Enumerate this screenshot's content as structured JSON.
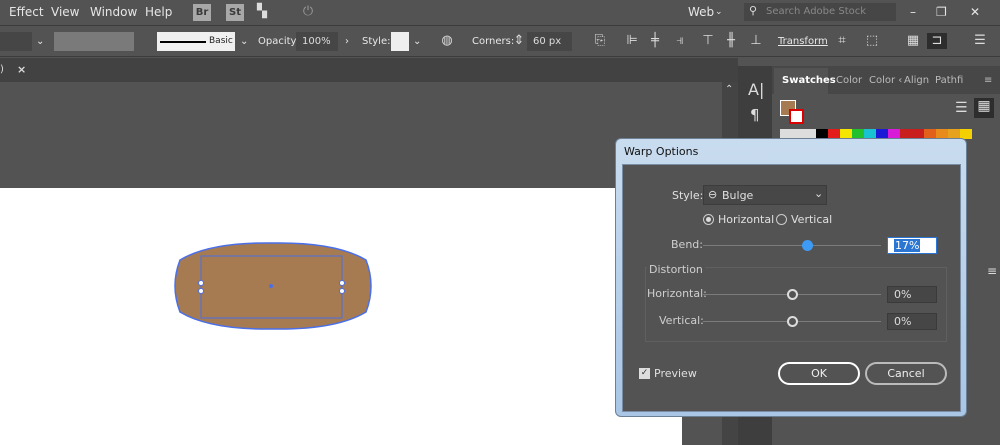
{
  "menu": {
    "items": [
      "Effect",
      "View",
      "Window",
      "Help"
    ],
    "bridge": "Br",
    "stock": "St",
    "workspace": "Web",
    "search_placeholder": "Search Adobe Stock"
  },
  "toolbar": {
    "stroke_style": "Basic",
    "opacity_label": "Opacity:",
    "opacity_value": "100%",
    "style_label": "Style:",
    "corners_label": "Corners:",
    "corners_value": "60 px",
    "transform_label": "Transform"
  },
  "tab": {
    "suffix": ")",
    "close": "×"
  },
  "panel": {
    "tabs": [
      "Swatches",
      "Color",
      "Color ‹",
      "Align",
      "Pathfi"
    ],
    "swatch_colors": [
      "#000000",
      "#e31b1b",
      "#f4e600",
      "#22c02a",
      "#19c2d1",
      "#1a1ad6",
      "#d81bd8",
      "#c81e1e",
      "#c81e1e",
      "#e0601c",
      "#e98b1c",
      "#e6a21c",
      "#f4d000"
    ],
    "fill_color": "#a77b52"
  },
  "dialog": {
    "title": "Warp Options",
    "style_label": "Style:",
    "style_value": "Bulge",
    "horizontal": "Horizontal",
    "vertical": "Vertical",
    "orientation": "Horizontal",
    "bend_label": "Bend:",
    "bend_value": "17%",
    "bend_percent": 17,
    "distortion_label": "Distortion",
    "dist_h_label": "Horizontal:",
    "dist_h_value": "0%",
    "dist_h_percent": 0,
    "dist_v_label": "Vertical:",
    "dist_v_value": "0%",
    "dist_v_percent": 0,
    "preview_label": "Preview",
    "preview_checked": true,
    "ok": "OK",
    "cancel": "Cancel"
  },
  "shape": {
    "fill": "#a77b52",
    "selection": "#4a6fe8"
  }
}
